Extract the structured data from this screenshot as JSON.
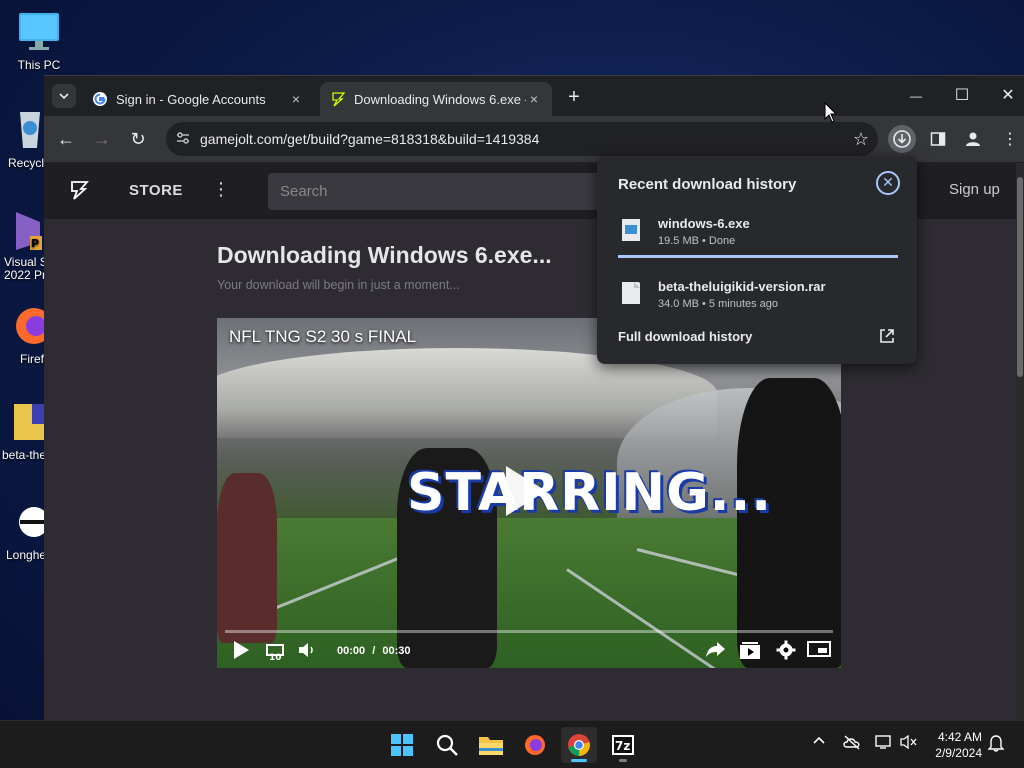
{
  "desktop": {
    "icons": [
      {
        "label": "This PC"
      },
      {
        "label": "Recycl"
      },
      {
        "label": "Visual S\n2022 Pr"
      },
      {
        "label": "Firef"
      },
      {
        "label": "beta-the"
      },
      {
        "label": "Longhe"
      }
    ]
  },
  "browser": {
    "tabs": [
      {
        "title": "Sign in - Google Accounts",
        "close": "×"
      },
      {
        "title": "Downloading Windows 6.exe - ",
        "close": "×"
      }
    ],
    "new_tab": "+",
    "window_controls": {
      "minimize": "—",
      "maximize": "☐",
      "close": "✕"
    },
    "nav": {
      "back": "←",
      "forward": "→",
      "reload": "↻"
    },
    "address": {
      "url": "gamejolt.com/get/build?game=818318&build=1419384",
      "site_info_icon": "tune-icon",
      "bookmark_icon": "☆"
    }
  },
  "site": {
    "store_label": "STORE",
    "more": "⋮",
    "search_placeholder": "Search",
    "signup": "Sign up",
    "title": "Downloading Windows 6.exe...",
    "subtitle": "Your download will begin in just a moment..."
  },
  "video": {
    "title": "NFL TNG S2 30 s FINAL",
    "overlay_text": "STARRING...",
    "time_current": "00:00",
    "time_separator": "/",
    "time_total": "00:30",
    "progress": 0.0
  },
  "downloads": {
    "header": "Recent download history",
    "items": [
      {
        "name": "windows-6.exe",
        "meta": "19.5 MB • Done",
        "icon": "exe-file-icon"
      },
      {
        "name": "beta-theluigikid-version.rar",
        "meta": "34.0 MB • 5 minutes ago",
        "icon": "file-icon"
      }
    ],
    "full_history": "Full download history"
  },
  "taskbar": {
    "clock_time": "4:42 AM",
    "clock_date": "2/9/2024"
  },
  "colors": {
    "accent": "#a8c7fa",
    "taskbar_active": "#4cc2ff",
    "page_bg": "#2e2c32"
  }
}
